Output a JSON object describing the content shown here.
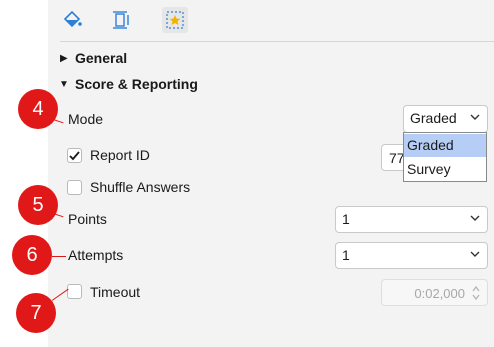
{
  "tabs": [
    {
      "icon": "paint-bucket-icon"
    },
    {
      "icon": "text-size-icon"
    },
    {
      "icon": "star-frame-icon",
      "active": true
    }
  ],
  "sections": {
    "general": {
      "label": "General",
      "expanded": false
    },
    "score_reporting": {
      "label": "Score & Reporting",
      "expanded": true
    }
  },
  "mode": {
    "label": "Mode",
    "value": "Graded",
    "options": [
      "Graded",
      "Survey"
    ],
    "highlighted": "Graded"
  },
  "report_id": {
    "label": "Report ID",
    "checked": true,
    "value": "77"
  },
  "shuffle": {
    "label": "Shuffle Answers",
    "checked": false
  },
  "points": {
    "label": "Points",
    "value": "1"
  },
  "attempts": {
    "label": "Attempts",
    "value": "1"
  },
  "timeout": {
    "label": "Timeout",
    "checked": false,
    "value": "0:02,000"
  },
  "badges": [
    "4",
    "5",
    "6",
    "7"
  ],
  "colors": {
    "badge": "#e01818",
    "highlight": "#b6cef5",
    "accent": "#2e7fd8",
    "star": "#f0b400"
  }
}
